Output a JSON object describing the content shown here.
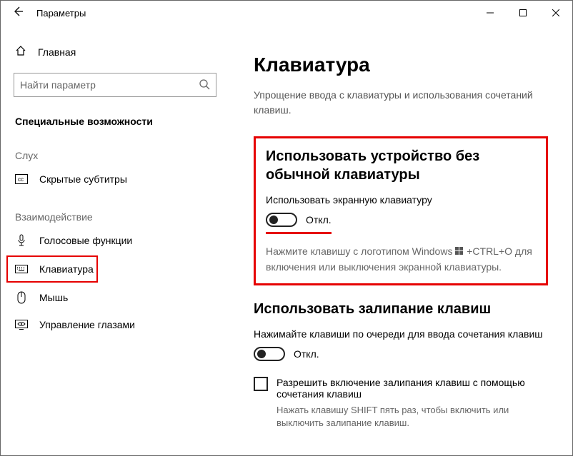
{
  "window": {
    "title": "Параметры"
  },
  "sidebar": {
    "home": "Главная",
    "search_placeholder": "Найти параметр",
    "section_header": "Специальные возможности",
    "groups": {
      "hearing": "Слух",
      "interaction": "Взаимодействие"
    },
    "items": {
      "captions": "Скрытые субтитры",
      "speech": "Голосовые функции",
      "keyboard": "Клавиатура",
      "mouse": "Мышь",
      "eye": "Управление глазами"
    }
  },
  "main": {
    "title": "Клавиатура",
    "subtitle": "Упрощение ввода с клавиатуры и использования сочетаний клавиш.",
    "osk": {
      "heading": "Использовать устройство без обычной клавиатуры",
      "label": "Использовать экранную клавиатуру",
      "state": "Откл.",
      "hint_before": "Нажмите клавишу с логотипом Windows ",
      "hint_after": " +CTRL+O для включения или выключения экранной клавиатуры."
    },
    "sticky": {
      "heading": "Использовать залипание клавиш",
      "label": "Нажимайте клавиши по очереди для ввода сочетания клавиш",
      "state": "Откл.",
      "checkbox": "Разрешить включение залипания клавиш с помощью сочетания клавиш",
      "hint": "Нажать клавишу SHIFT пять раз, чтобы включить или выключить залипание клавиш."
    }
  }
}
